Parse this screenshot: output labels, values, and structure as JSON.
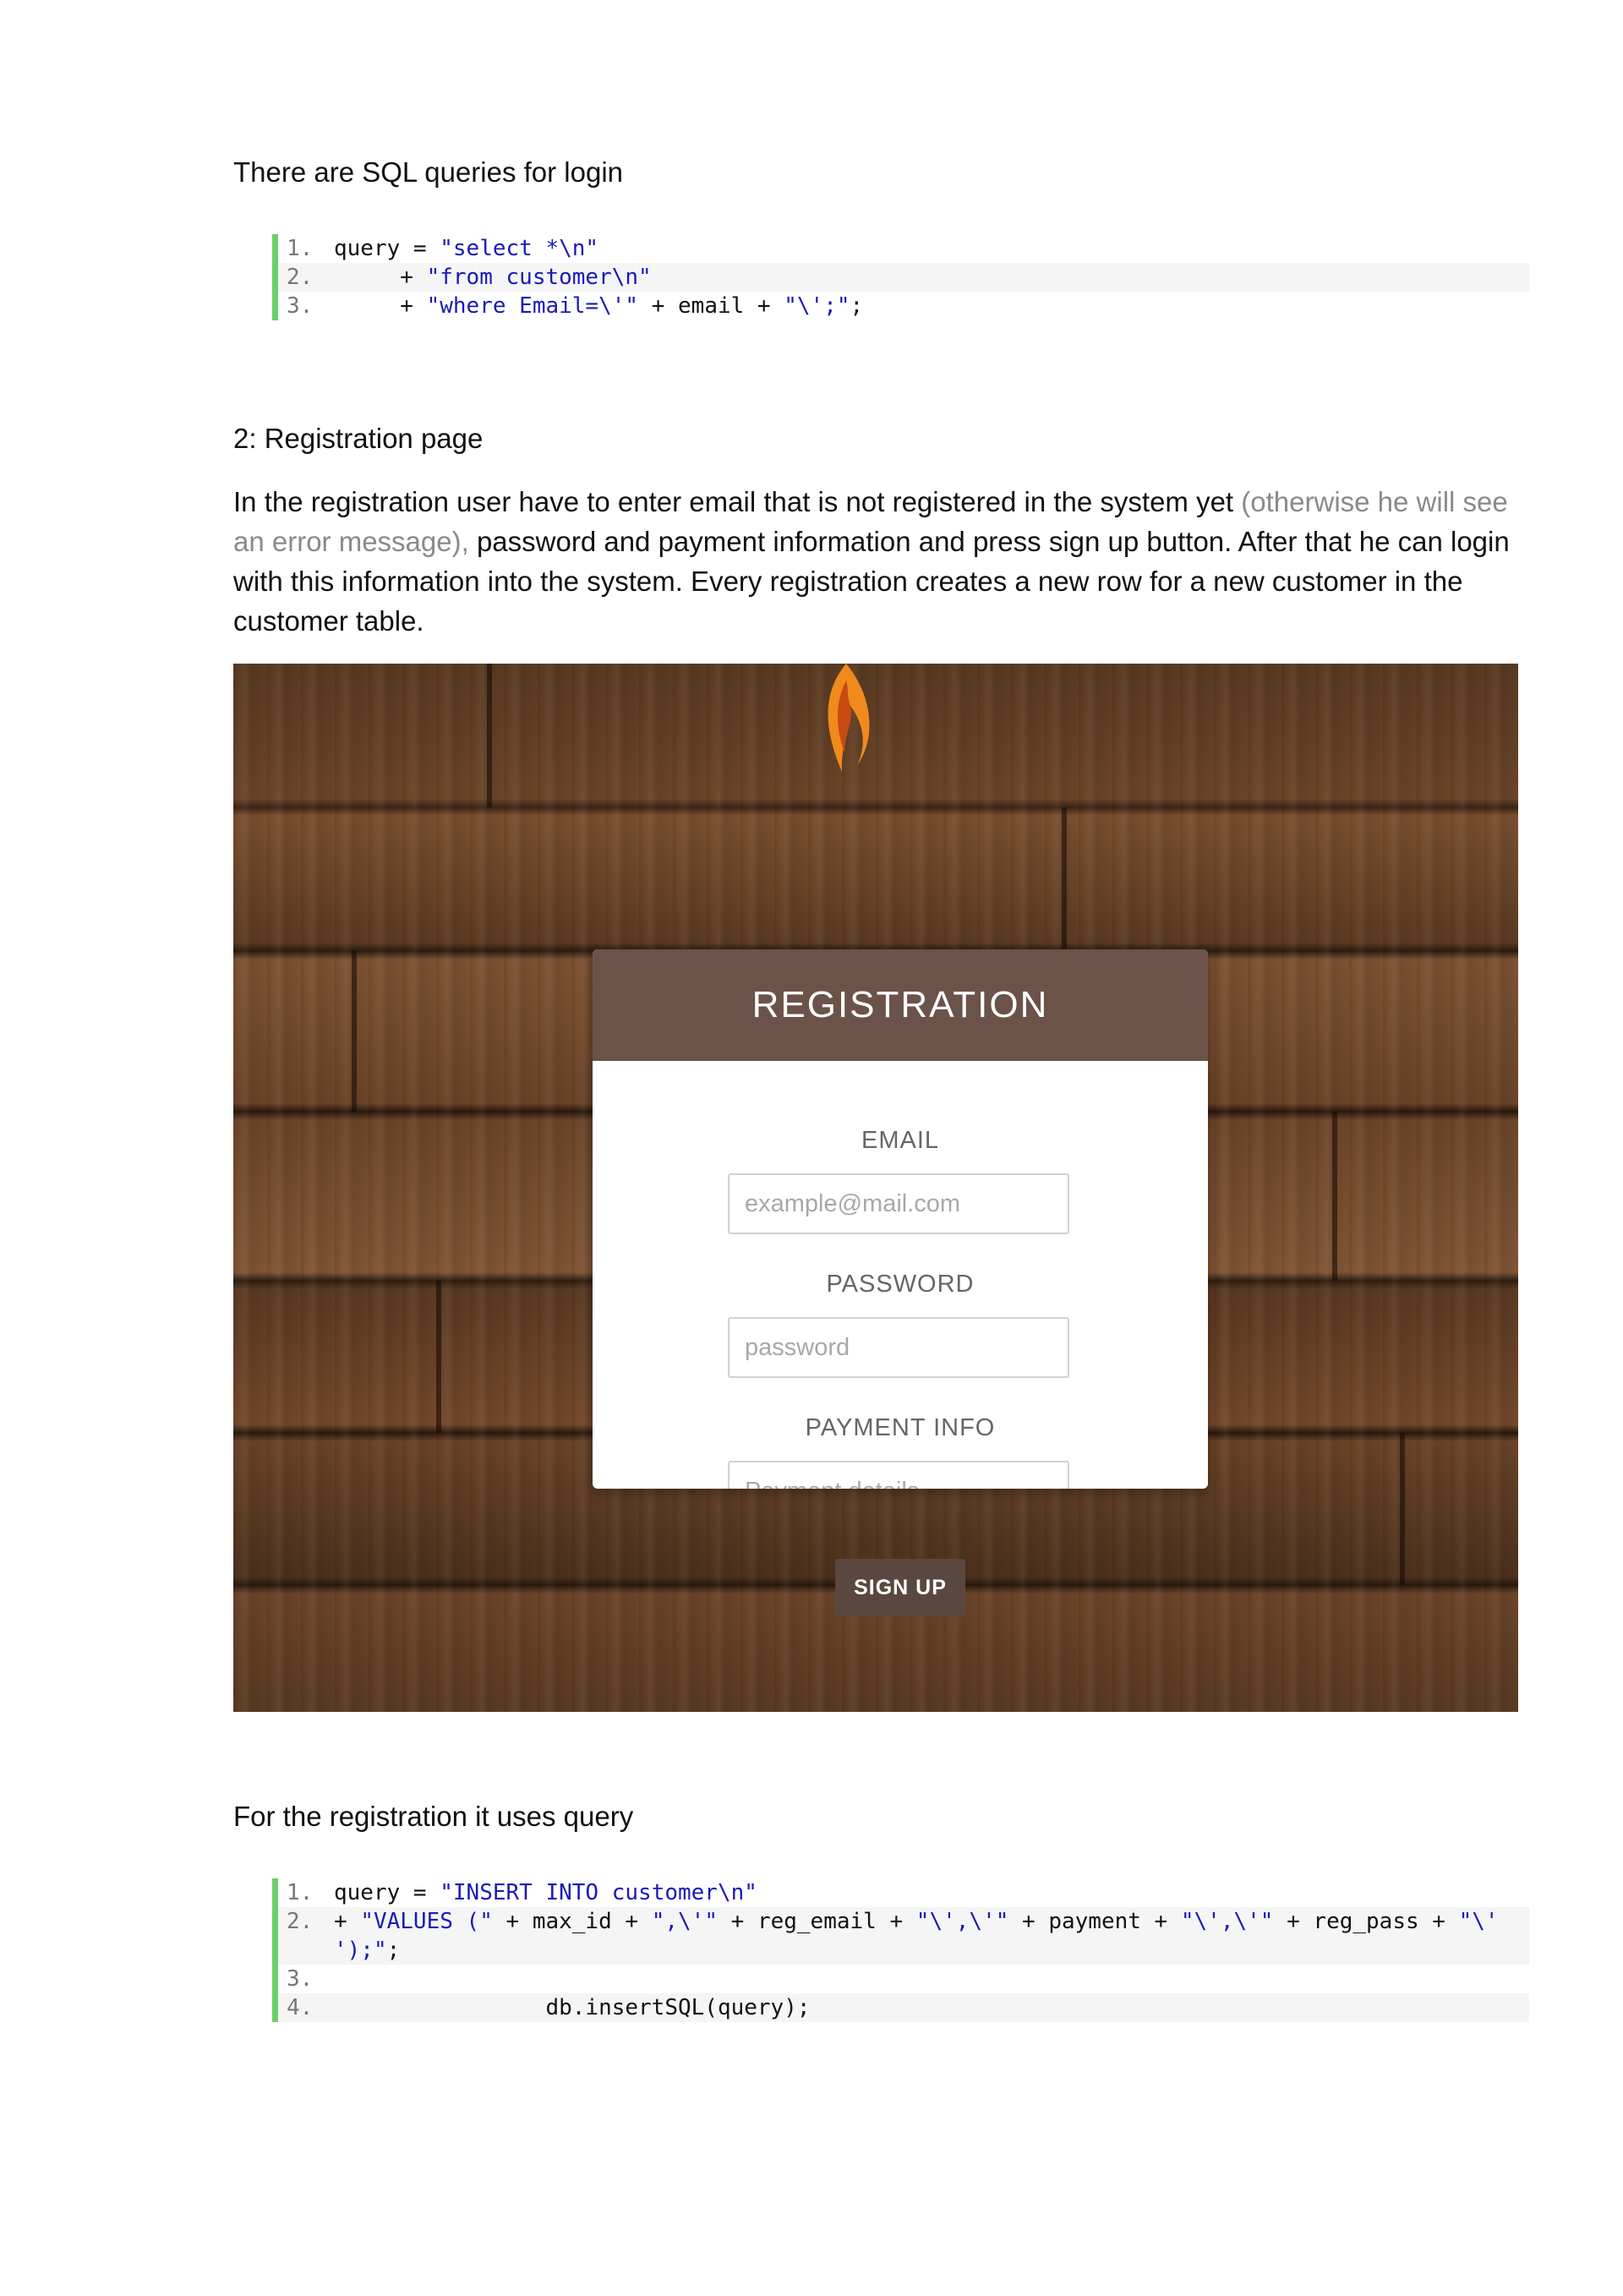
{
  "intro_login": "There are SQL queries for login",
  "login_code": [
    {
      "num": "1.",
      "parts": [
        {
          "t": "query = ",
          "c": ""
        },
        {
          "t": "\"select *\\n\"",
          "c": "str"
        }
      ]
    },
    {
      "num": "2.",
      "parts": [
        {
          "t": "     + ",
          "c": ""
        },
        {
          "t": "\"from customer\\n\"",
          "c": "str"
        }
      ]
    },
    {
      "num": "3.",
      "parts": [
        {
          "t": "     + ",
          "c": ""
        },
        {
          "t": "\"where Email=\\'\"",
          "c": "str"
        },
        {
          "t": " + email + ",
          "c": ""
        },
        {
          "t": "\"\\';\"",
          "c": "str"
        },
        {
          "t": ";",
          "c": ""
        }
      ]
    }
  ],
  "section_heading": "2: Registration page",
  "registration_paragraph": {
    "part1": "In the registration user have to enter email that is not registered in the system yet ",
    "muted": "(otherwise he will see an error message),",
    "part2": " password and payment information and press sign up button. After that he can login with this information into the system. Every registration creates a new row for a new customer in the customer table."
  },
  "registration_form": {
    "title": "REGISTRATION",
    "email_label": "EMAIL",
    "email_placeholder": "example@mail.com",
    "password_label": "PASSWORD",
    "password_placeholder": "password",
    "payment_label": "PAYMENT INFO",
    "payment_placeholder": "Payment details",
    "signup_label": "SIGN UP"
  },
  "intro_registration": "For the registration it uses query",
  "registration_code": [
    {
      "num": "1.",
      "parts": [
        {
          "t": "query = ",
          "c": ""
        },
        {
          "t": "\"INSERT INTO customer\\n\"",
          "c": "str"
        }
      ]
    },
    {
      "num": "2.",
      "parts": [
        {
          "t": "+ ",
          "c": ""
        },
        {
          "t": "\"VALUES (\"",
          "c": "str"
        },
        {
          "t": " + max_id + ",
          "c": ""
        },
        {
          "t": "\",\\'\"",
          "c": "str"
        },
        {
          "t": " + reg_email + ",
          "c": ""
        },
        {
          "t": "\"\\',\\'\"",
          "c": "str"
        },
        {
          "t": " + payment + ",
          "c": ""
        },
        {
          "t": "\"\\',\\'\"",
          "c": "str"
        },
        {
          "t": " + reg_pass + ",
          "c": ""
        },
        {
          "t": "\"\\'",
          "c": "str"
        },
        {
          "t": "\n",
          "c": ""
        },
        {
          "t": "');\"",
          "c": "str"
        },
        {
          "t": ";",
          "c": ""
        }
      ]
    },
    {
      "num": "3.",
      "parts": []
    },
    {
      "num": "4.",
      "parts": [
        {
          "t": "                db.insertSQL(query);",
          "c": ""
        }
      ]
    }
  ]
}
